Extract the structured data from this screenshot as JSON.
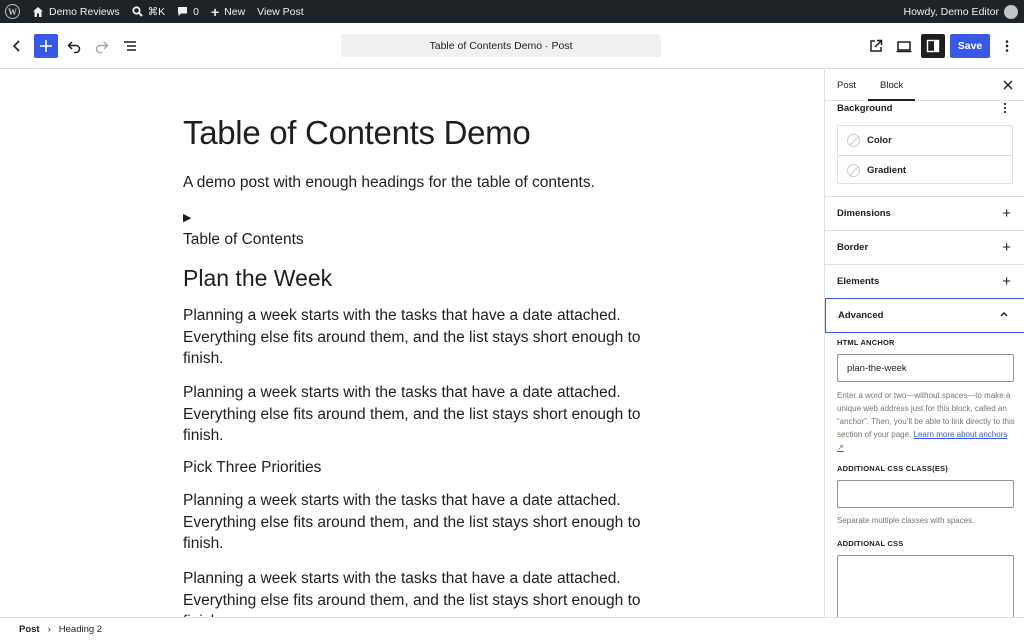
{
  "adminbar": {
    "site_name": "Demo Reviews",
    "search_shortcut": "⌘K",
    "comments_count": "0",
    "new_label": "New",
    "view_post_label": "View Post",
    "greeting": "Howdy, Demo Editor"
  },
  "header": {
    "document_title": "Table of Contents Demo · Post",
    "save_label": "Save"
  },
  "canvas": {
    "post_title": "Table of Contents Demo",
    "excerpt": "A demo post with enough headings for the table of contents.",
    "toc_toggle": "▶",
    "toc_label": "Table of Contents",
    "heading_2": "Plan the Week",
    "paragraph_text": "Planning a week starts with the tasks that have a date attached. Everything else fits around them, and the list stays short enough to finish.",
    "heading_3": "Pick Three Priorities"
  },
  "sidebar": {
    "tab_post": "Post",
    "tab_block": "Block",
    "background_label": "Background",
    "color_label": "Color",
    "gradient_label": "Gradient",
    "dimensions_label": "Dimensions",
    "border_label": "Border",
    "elements_label": "Elements",
    "advanced_label": "Advanced",
    "html_anchor_label": "HTML ANCHOR",
    "html_anchor_value": "plan-the-week",
    "anchor_help": "Enter a word or two—without spaces—to make a unique web address just for this block, called an “anchor”. Then, you’ll be able to link directly to this section of your page.",
    "anchor_help_link": "Learn more about anchors",
    "css_classes_label": "ADDITIONAL CSS CLASS(ES)",
    "css_classes_value": "",
    "css_classes_help": "Separate multiple classes with spaces.",
    "additional_css_label": "ADDITIONAL CSS"
  },
  "footer": {
    "crumb_post": "Post",
    "crumb_separator": "›",
    "crumb_block": "Heading 2"
  },
  "colors": {
    "accent": "#3858e9",
    "adminbar_bg": "#1d2327"
  }
}
